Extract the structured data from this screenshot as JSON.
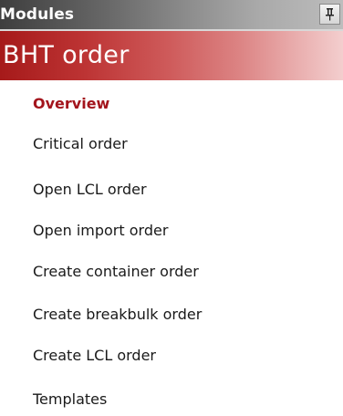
{
  "header": {
    "title": "Modules",
    "pin_icon": "pin-icon"
  },
  "module": {
    "title": "BHT order",
    "accent_color": "#a61a1a"
  },
  "menu": {
    "active_color": "#a3141c",
    "items": [
      {
        "label": "Overview",
        "active": true
      },
      {
        "label": "Critical order",
        "active": false
      },
      {
        "label": "Open LCL order",
        "active": false
      },
      {
        "label": "Open import order",
        "active": false
      },
      {
        "label": "Create container order",
        "active": false
      },
      {
        "label": "Create breakbulk order",
        "active": false
      },
      {
        "label": "Create LCL order",
        "active": false
      },
      {
        "label": "Templates",
        "active": false
      }
    ]
  }
}
